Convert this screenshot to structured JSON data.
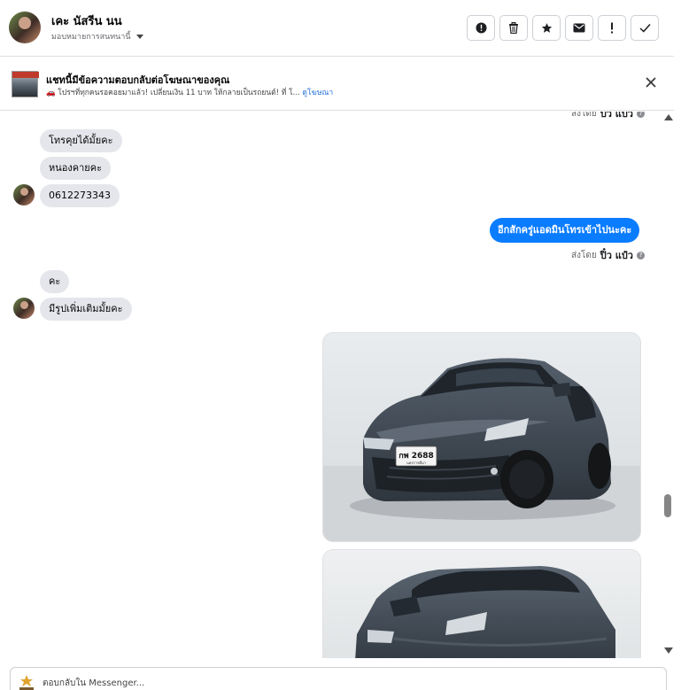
{
  "contact": {
    "name": "เคะ นัสรีน นน",
    "assign_label": "มอบหมายการสนทนานี้"
  },
  "actions": [
    {
      "name": "spam-button",
      "icon": "!",
      "shape": "circle"
    },
    {
      "name": "delete-button",
      "icon": "🗑"
    },
    {
      "name": "star-button",
      "icon": "★"
    },
    {
      "name": "mark-unread-button",
      "icon": "✉"
    },
    {
      "name": "follow-up-button",
      "icon": "!"
    },
    {
      "name": "mark-done-button",
      "icon": "✓"
    }
  ],
  "ad": {
    "title": "แชทนี้มีข้อความตอบกลับต่อโฆษณาของคุณ",
    "description": "🚗 โปรฯที่ทุกคนรอคอยมาแล้ว! เปลี่ยนเงิน 11 บาท ให้กลายเป็นรถยนต์! ที่ โ...",
    "link_label": "ดูโฆษณา"
  },
  "messages": {
    "sent_by_prefix": "ส่งโดย",
    "sent_by_name": "ปิ๋ว แป๋ว",
    "incoming_group1": [
      "โทรคุยได้มั้ยคะ",
      "หนองคายคะ",
      "0612273343"
    ],
    "outgoing1": "อีกสักครู่แอดมินโทรเข้าไปนะคะ",
    "incoming_group2": [
      "คะ",
      "มีรูปเพิ่มเติมมั้ยคะ"
    ],
    "license_plate": "กพ 2688",
    "plate_sub": "นครราชสีมา"
  },
  "composer": {
    "placeholder": "ตอบกลับใน Messenger..."
  },
  "colors": {
    "outgoing_bubble": "#0a7cff",
    "incoming_bubble": "#e4e6eb",
    "link": "#216fdb"
  }
}
